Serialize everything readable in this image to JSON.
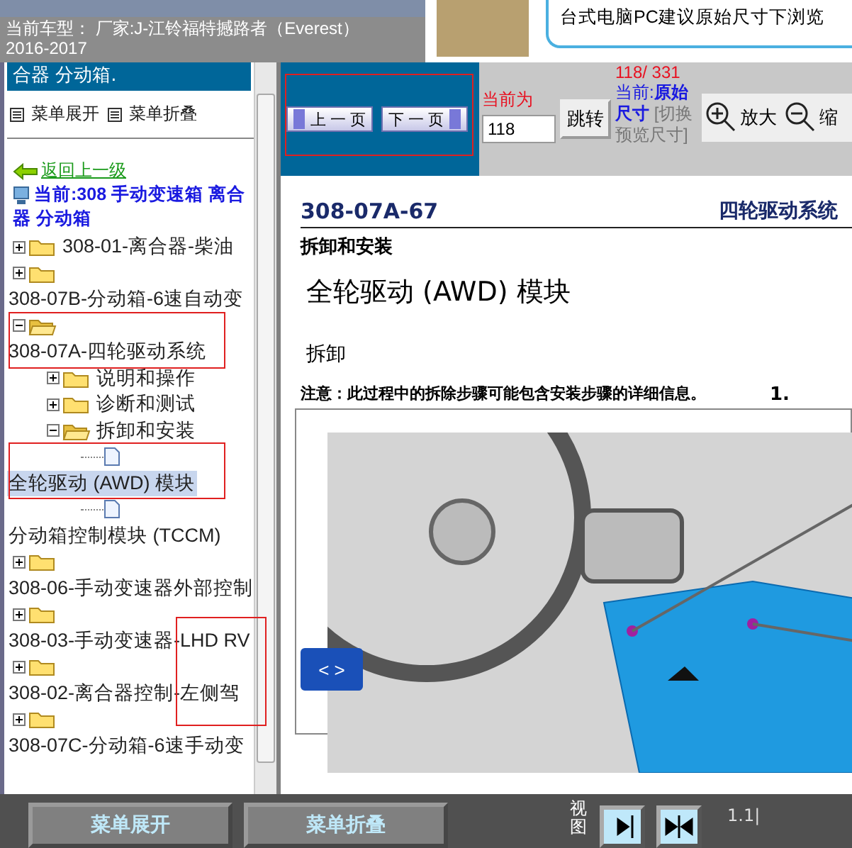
{
  "header": {
    "title": "当前车型： 厂家:J-江铃福特撼路者（Everest）",
    "year": "2016-2017",
    "notice": "台式电脑PC建议原始尺寸下浏览"
  },
  "sidebar": {
    "heading": "合器 分动箱.",
    "menu_actions": [
      "菜单展开",
      "菜单折叠"
    ],
    "back_link": "返回上一级",
    "current": "当前:308 手动变速箱 离合器 分动箱",
    "tree": [
      {
        "label": "308-01-离合器-柴油",
        "kind": "folder",
        "expanded": false,
        "selected": false
      },
      {
        "label": "308-07B-分动箱-6速自动变",
        "kind": "folder",
        "expanded": false,
        "selected": false
      },
      {
        "label": "308-07A-四轮驱动系统",
        "kind": "folder",
        "expanded": true,
        "selected": false,
        "marked": true,
        "children": [
          {
            "label": "说明和操作",
            "kind": "folder",
            "expanded": false,
            "selected": false
          },
          {
            "label": "诊断和测试",
            "kind": "folder",
            "expanded": false,
            "selected": false
          },
          {
            "label": "拆卸和安装",
            "kind": "folder",
            "expanded": true,
            "selected": false,
            "children": [
              {
                "label": "全轮驱动 (AWD) 模块",
                "kind": "page",
                "selected": true,
                "marked": true
              },
              {
                "label": "分动箱控制模块 (TCCM)",
                "kind": "page",
                "selected": false
              }
            ]
          }
        ]
      },
      {
        "label": "308-06-手动变速器外部控制",
        "kind": "folder",
        "expanded": false,
        "selected": false
      },
      {
        "label": "308-03-手动变速器-LHD RV",
        "kind": "folder",
        "expanded": false,
        "selected": false
      },
      {
        "label": "308-02-离合器控制-左侧驾",
        "kind": "folder",
        "expanded": false,
        "selected": false
      },
      {
        "label": "308-07C-分动箱-6速手动变",
        "kind": "folder",
        "expanded": false,
        "selected": false
      }
    ]
  },
  "toolbar": {
    "prev": "上 一 页",
    "next": "下 一 页",
    "current_label": "当前为",
    "page_value": "118",
    "jump": "跳转",
    "page_count": "118/ 331",
    "size_current": "当前:",
    "size_value": "原始尺寸",
    "size_switch": "[切换预览尺寸]",
    "zoom_in": "放大",
    "zoom_out": "缩"
  },
  "document": {
    "code": "308-07A-67",
    "section": "四轮驱动系统",
    "category": "拆卸和安装",
    "title": "全轮驱动 (AWD) 模块",
    "subtitle": "拆卸",
    "note": "注意：此过程中的拆除步骤可能包含安装步骤的详细信息。",
    "step": "1.",
    "nav": "< >"
  },
  "bottom_bar": {
    "buttons": [
      "菜单展开",
      "菜单折叠"
    ],
    "view_label": "视图",
    "version": "1.1|"
  }
}
